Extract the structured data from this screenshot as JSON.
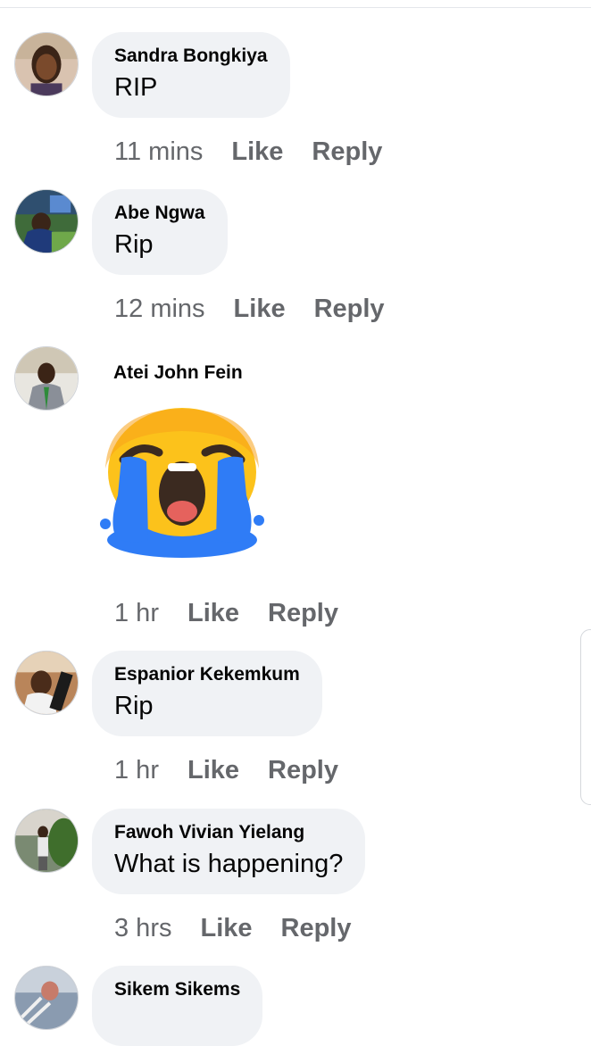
{
  "comments": [
    {
      "author": "Sandra Bongkiya",
      "text": "RIP",
      "time": "11 mins",
      "like": "Like",
      "reply": "Reply"
    },
    {
      "author": "Abe Ngwa",
      "text": "Rip",
      "time": "12 mins",
      "like": "Like",
      "reply": "Reply"
    },
    {
      "author": "Atei John Fein",
      "sticker": "loudly-crying-face-sticker",
      "time": "1 hr",
      "like": "Like",
      "reply": "Reply"
    },
    {
      "author": "Espanior Kekemkum",
      "text": "Rip",
      "time": "1 hr",
      "like": "Like",
      "reply": "Reply"
    },
    {
      "author": "Fawoh Vivian Yielang",
      "text": "What is happening?",
      "time": "3 hrs",
      "like": "Like",
      "reply": "Reply"
    },
    {
      "author": "Sikem Sikems"
    }
  ],
  "colors": {
    "bubble": "#f0f2f5",
    "meta": "#65676b",
    "text": "#050505",
    "tears": "#2f7cf6",
    "face": "#fcc21b"
  }
}
